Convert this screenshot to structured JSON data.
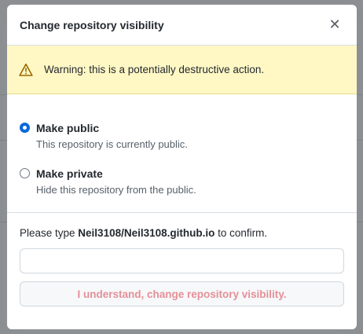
{
  "modal": {
    "title": "Change repository visibility",
    "close_glyph": "✕"
  },
  "warning": {
    "text": "Warning: this is a potentially destructive action."
  },
  "options": [
    {
      "label": "Make public",
      "description": "This repository is currently public.",
      "checked": true
    },
    {
      "label": "Make private",
      "description": "Hide this repository from the public.",
      "checked": false
    }
  ],
  "confirm": {
    "prefix": "Please type ",
    "repo": "Neil3108/Neil3108.github.io",
    "suffix": " to confirm.",
    "input_value": "",
    "button_label": "I understand, change repository visibility."
  },
  "colors": {
    "accent": "#0969da",
    "warning_bg": "#fff8c5",
    "danger_disabled": "#e58f97"
  }
}
